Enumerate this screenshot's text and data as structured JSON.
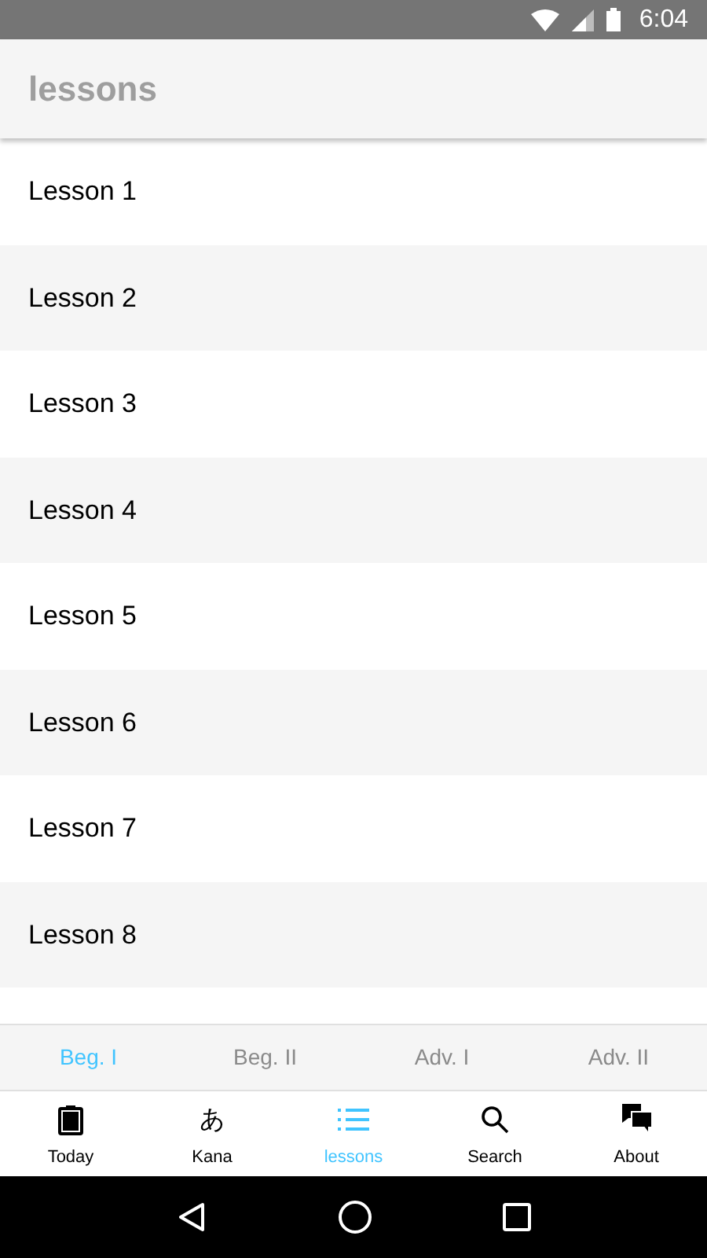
{
  "status_bar": {
    "time": "6:04"
  },
  "header": {
    "title": "lessons"
  },
  "lessons": [
    {
      "label": "Lesson 1"
    },
    {
      "label": "Lesson 2"
    },
    {
      "label": "Lesson 3"
    },
    {
      "label": "Lesson 4"
    },
    {
      "label": "Lesson 5"
    },
    {
      "label": "Lesson 6"
    },
    {
      "label": "Lesson 7"
    },
    {
      "label": "Lesson 8"
    }
  ],
  "level_tabs": [
    {
      "label": "Beg. I",
      "selected": true
    },
    {
      "label": "Beg. II",
      "selected": false
    },
    {
      "label": "Adv. I",
      "selected": false
    },
    {
      "label": "Adv. II",
      "selected": false
    }
  ],
  "bottom_nav": [
    {
      "label": "Today",
      "kind": "clipboard",
      "selected": false
    },
    {
      "label": "Kana",
      "kind": "glyph",
      "glyph": "あ",
      "selected": false
    },
    {
      "label": "lessons",
      "kind": "list",
      "selected": true
    },
    {
      "label": "Search",
      "kind": "search",
      "selected": false
    },
    {
      "label": "About",
      "kind": "chat",
      "selected": false
    }
  ]
}
